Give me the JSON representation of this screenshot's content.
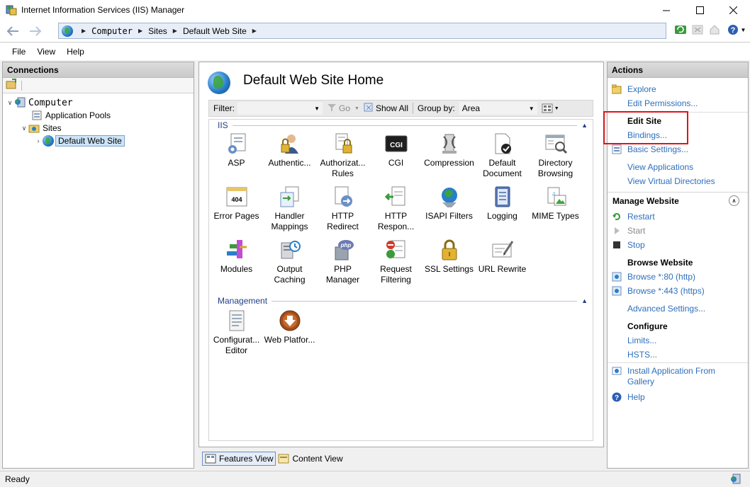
{
  "window": {
    "title": "Internet Information Services (IIS) Manager"
  },
  "address": {
    "crumbs": [
      "Computer",
      "Sites",
      "Default Web Site"
    ]
  },
  "menu": [
    "File",
    "View",
    "Help"
  ],
  "connections": {
    "header": "Connections",
    "tree": [
      {
        "label": "Computer"
      },
      {
        "label": "Application Pools"
      },
      {
        "label": "Sites"
      },
      {
        "label": "Default Web Site"
      }
    ]
  },
  "main": {
    "title": "Default Web Site Home",
    "filter_label": "Filter:",
    "go_label": "Go",
    "show_all_label": "Show All",
    "group_by_label": "Group by:",
    "group_by_value": "Area",
    "groups": [
      {
        "name": "IIS",
        "features": [
          {
            "label": "ASP",
            "icon": "asp-icon"
          },
          {
            "label": "Authentic...",
            "icon": "authentication-icon"
          },
          {
            "label": "Authorizat... Rules",
            "icon": "authorization-icon"
          },
          {
            "label": "CGI",
            "icon": "cgi-icon"
          },
          {
            "label": "Compression",
            "icon": "compression-icon"
          },
          {
            "label": "Default Document",
            "icon": "default-document-icon"
          },
          {
            "label": "Directory Browsing",
            "icon": "directory-browsing-icon"
          },
          {
            "label": "Error Pages",
            "icon": "error-pages-icon"
          },
          {
            "label": "Handler Mappings",
            "icon": "handler-mappings-icon"
          },
          {
            "label": "HTTP Redirect",
            "icon": "http-redirect-icon"
          },
          {
            "label": "HTTP Respon...",
            "icon": "http-response-icon"
          },
          {
            "label": "ISAPI Filters",
            "icon": "isapi-filters-icon"
          },
          {
            "label": "Logging",
            "icon": "logging-icon"
          },
          {
            "label": "MIME Types",
            "icon": "mime-types-icon"
          },
          {
            "label": "Modules",
            "icon": "modules-icon"
          },
          {
            "label": "Output Caching",
            "icon": "output-caching-icon"
          },
          {
            "label": "PHP Manager",
            "icon": "php-manager-icon"
          },
          {
            "label": "Request Filtering",
            "icon": "request-filtering-icon"
          },
          {
            "label": "SSL Settings",
            "icon": "ssl-settings-icon"
          },
          {
            "label": "URL Rewrite",
            "icon": "url-rewrite-icon"
          }
        ]
      },
      {
        "name": "Management",
        "features": [
          {
            "label": "Configurat... Editor",
            "icon": "configuration-editor-icon"
          },
          {
            "label": "Web Platfor...",
            "icon": "web-platform-icon"
          }
        ]
      }
    ],
    "views": {
      "features": "Features View",
      "content": "Content View"
    }
  },
  "actions": {
    "header": "Actions",
    "explore": "Explore",
    "edit_permissions": "Edit Permissions...",
    "edit_site": "Edit Site",
    "bindings": "Bindings...",
    "basic_settings": "Basic Settings...",
    "view_applications": "View Applications",
    "view_virtual_directories": "View Virtual Directories",
    "manage_website": "Manage Website",
    "restart": "Restart",
    "start": "Start",
    "stop": "Stop",
    "browse_website": "Browse Website",
    "browse_80": "Browse *:80 (http)",
    "browse_443": "Browse *:443 (https)",
    "advanced_settings": "Advanced Settings...",
    "configure": "Configure",
    "limits": "Limits...",
    "hsts": "HSTS...",
    "install_app": "Install Application From Gallery",
    "help": "Help"
  },
  "status": {
    "text": "Ready"
  },
  "colors": {
    "link": "#2e6fbb",
    "highlight_box": "#e0131a",
    "group_header": "#1e3f8a"
  }
}
